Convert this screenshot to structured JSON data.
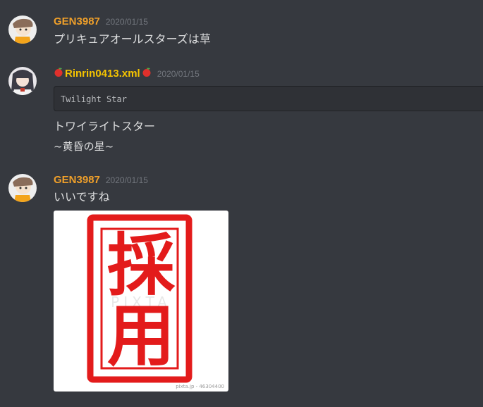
{
  "messages": [
    {
      "username": "GEN3987",
      "timestamp": "2020/01/15",
      "lines": [
        "プリキュアオールスターズは草"
      ]
    },
    {
      "username": "Rinrin0413.xml",
      "timestamp": "2020/01/15",
      "code": "Twilight Star",
      "lines": [
        "トワイライトスター",
        "~黄昏の星~"
      ]
    },
    {
      "username": "GEN3987",
      "timestamp": "2020/01/15",
      "lines": [
        "いいですね"
      ],
      "image": {
        "stamp_text_1": "採",
        "stamp_text_2": "用",
        "watermark": "PIXTA",
        "credit": "pixta.jp - 46304400"
      }
    }
  ],
  "colors": {
    "background": "#36393f",
    "username_orange": "#f0a02a",
    "username_yellow": "#f5c400",
    "timestamp": "#72767d",
    "stamp_red": "#e31b1b"
  },
  "icons": {
    "apple_left": "red-apple-emoji",
    "apple_right": "red-apple-emoji"
  }
}
